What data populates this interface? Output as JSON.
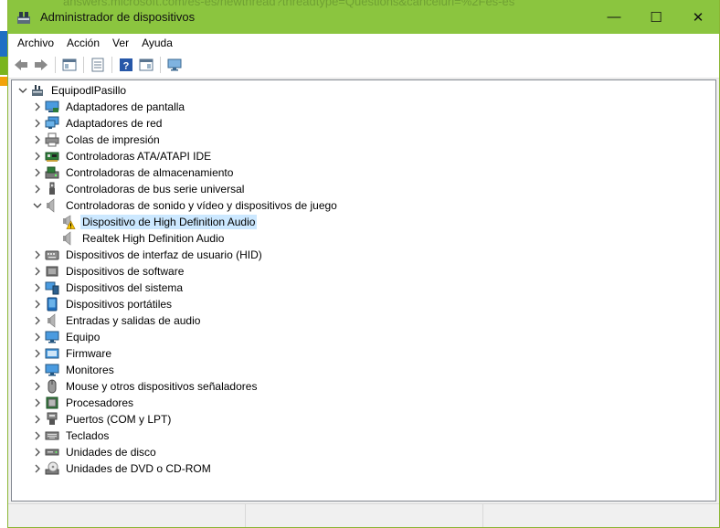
{
  "window": {
    "title": "Administrador de dispositivos",
    "background_url": "answers.microsoft.com/es-es/newthread?threadtype=Questions&cancelurl=%2Fes-es",
    "minimize": "—",
    "maximize": "☐",
    "close": "✕",
    "accent_color": "#8bc53f"
  },
  "menu": {
    "archivo": "Archivo",
    "accion": "Acción",
    "ver": "Ver",
    "ayuda": "Ayuda"
  },
  "tree": {
    "root": "EquipodlPasillo",
    "items": [
      {
        "label": "Adaptadores de pantalla",
        "icon": "display-adapter-icon"
      },
      {
        "label": "Adaptadores de red",
        "icon": "network-adapter-icon"
      },
      {
        "label": "Colas de impresión",
        "icon": "printer-icon"
      },
      {
        "label": "Controladoras ATA/ATAPI IDE",
        "icon": "ide-controller-icon"
      },
      {
        "label": "Controladoras de almacenamiento",
        "icon": "storage-controller-icon"
      },
      {
        "label": "Controladoras de bus serie universal",
        "icon": "usb-icon"
      },
      {
        "label": "Controladoras de sonido y vídeo y dispositivos de juego",
        "icon": "speaker-icon"
      },
      {
        "label": "Dispositivos de interfaz de usuario (HID)",
        "icon": "hid-icon"
      },
      {
        "label": "Dispositivos de software",
        "icon": "software-device-icon"
      },
      {
        "label": "Dispositivos del sistema",
        "icon": "system-device-icon"
      },
      {
        "label": "Dispositivos portátiles",
        "icon": "portable-device-icon"
      },
      {
        "label": "Entradas y salidas de audio",
        "icon": "audio-io-icon"
      },
      {
        "label": "Equipo",
        "icon": "computer-icon"
      },
      {
        "label": "Firmware",
        "icon": "firmware-icon"
      },
      {
        "label": "Monitores",
        "icon": "monitor-icon"
      },
      {
        "label": "Mouse y otros dispositivos señaladores",
        "icon": "mouse-icon"
      },
      {
        "label": "Procesadores",
        "icon": "processor-icon"
      },
      {
        "label": "Puertos (COM y LPT)",
        "icon": "port-icon"
      },
      {
        "label": "Teclados",
        "icon": "keyboard-icon"
      },
      {
        "label": "Unidades de disco",
        "icon": "disk-drive-icon"
      },
      {
        "label": "Unidades de DVD o CD-ROM",
        "icon": "dvd-drive-icon"
      }
    ],
    "sound_children": [
      {
        "label": "Dispositivo de High Definition Audio",
        "icon": "warning-speaker-icon"
      },
      {
        "label": "Realtek High Definition Audio",
        "icon": "speaker-icon"
      }
    ]
  }
}
